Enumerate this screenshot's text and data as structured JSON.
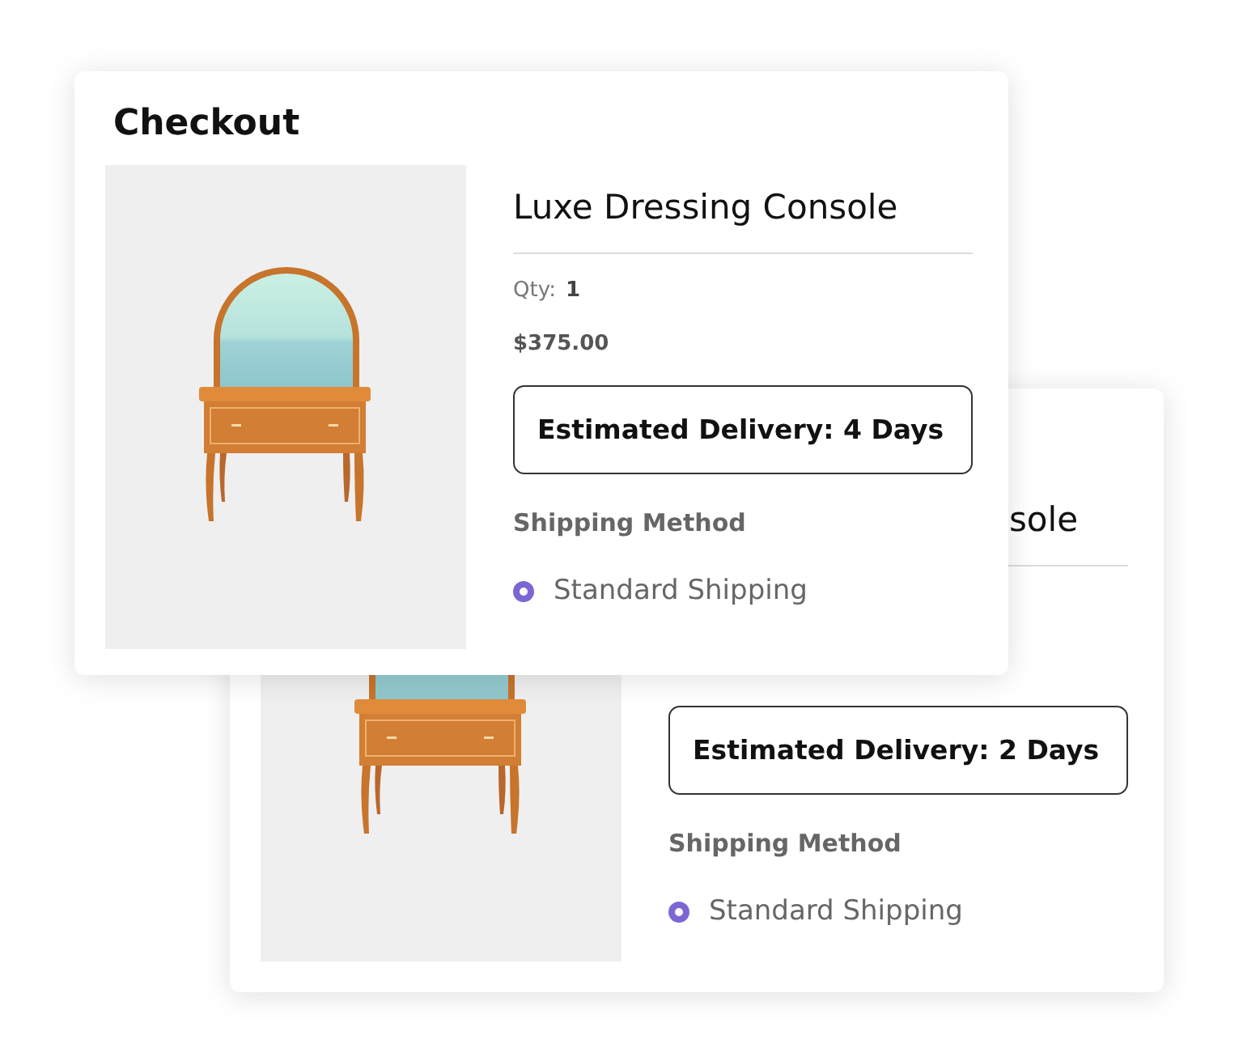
{
  "back_card": {
    "product": "sole",
    "delivery": "Estimated Delivery: 2 Days",
    "shipping_heading": "Shipping Method",
    "shipping_options": [
      {
        "label": "Standard Shipping",
        "selected": true
      }
    ]
  },
  "front_card": {
    "title": "Checkout",
    "product": "Luxe Dressing Console",
    "qty_label": "Qty:",
    "qty": "1",
    "price": "$375.00",
    "delivery": "Estimated Delivery: 4 Days",
    "shipping_heading": "Shipping Method",
    "shipping_options": [
      {
        "label": "Standard Shipping",
        "selected": true
      }
    ]
  }
}
